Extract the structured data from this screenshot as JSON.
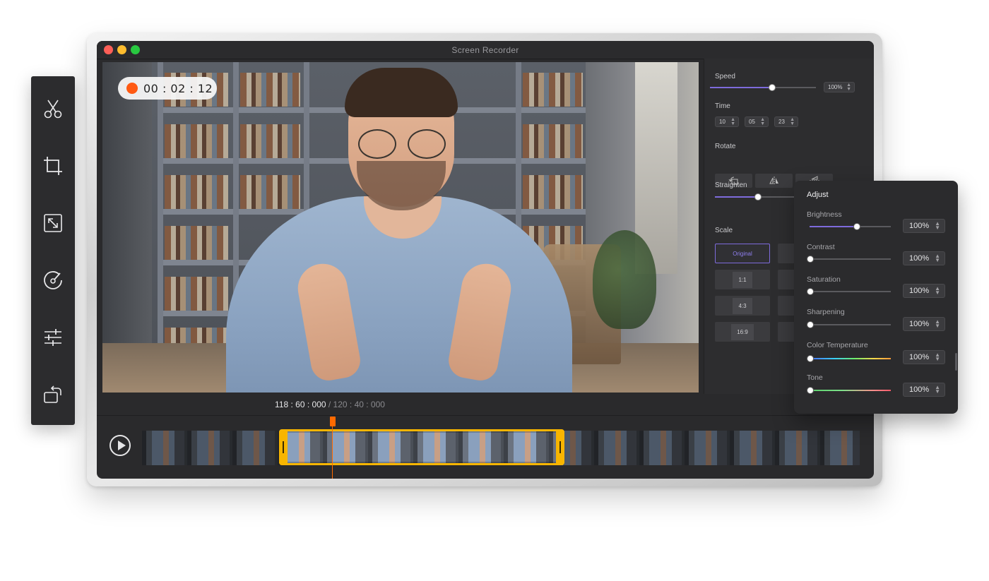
{
  "window": {
    "title": "Screen Recorder"
  },
  "recording": {
    "timer": "00 : 02 : 12"
  },
  "settings": {
    "speed": {
      "label": "Speed",
      "value": "100%",
      "level": 0.58
    },
    "time": {
      "label": "Time",
      "hours": "10",
      "minutes": "05",
      "seconds": "23"
    },
    "rotate": {
      "label": "Rotate"
    },
    "straighten": {
      "label": "Straighten",
      "level": 0.5
    },
    "scale": {
      "label": "Scale",
      "options": [
        "Original",
        "1:1",
        "4:3",
        "16:9"
      ],
      "selected": "Original"
    }
  },
  "timeline": {
    "current": "118 : 60 : 000",
    "total": " / 120 : 40 : 000"
  },
  "toolbar": {
    "tools": [
      "scissors-icon",
      "crop-icon",
      "resize-icon",
      "speed-icon",
      "adjust-sliders-icon",
      "rotate-icon"
    ]
  },
  "adjust": {
    "title": "Adjust",
    "items": [
      {
        "label": "Brightness",
        "value": "100%",
        "level": 0.57
      },
      {
        "label": "Contrast",
        "value": "100%",
        "level": 0.0
      },
      {
        "label": "Saturation",
        "value": "100%",
        "level": 0.0
      },
      {
        "label": "Sharpening",
        "value": "100%",
        "level": 0.0
      },
      {
        "label": "Color Temperature",
        "value": "100%",
        "level": 0.0
      },
      {
        "label": "Tone",
        "value": "100%",
        "level": 0.0
      }
    ]
  },
  "colors": {
    "accent": "#7e6bdc",
    "selection": "#f7b500",
    "playhead": "#ff6a00",
    "record": "#ff5a12"
  }
}
